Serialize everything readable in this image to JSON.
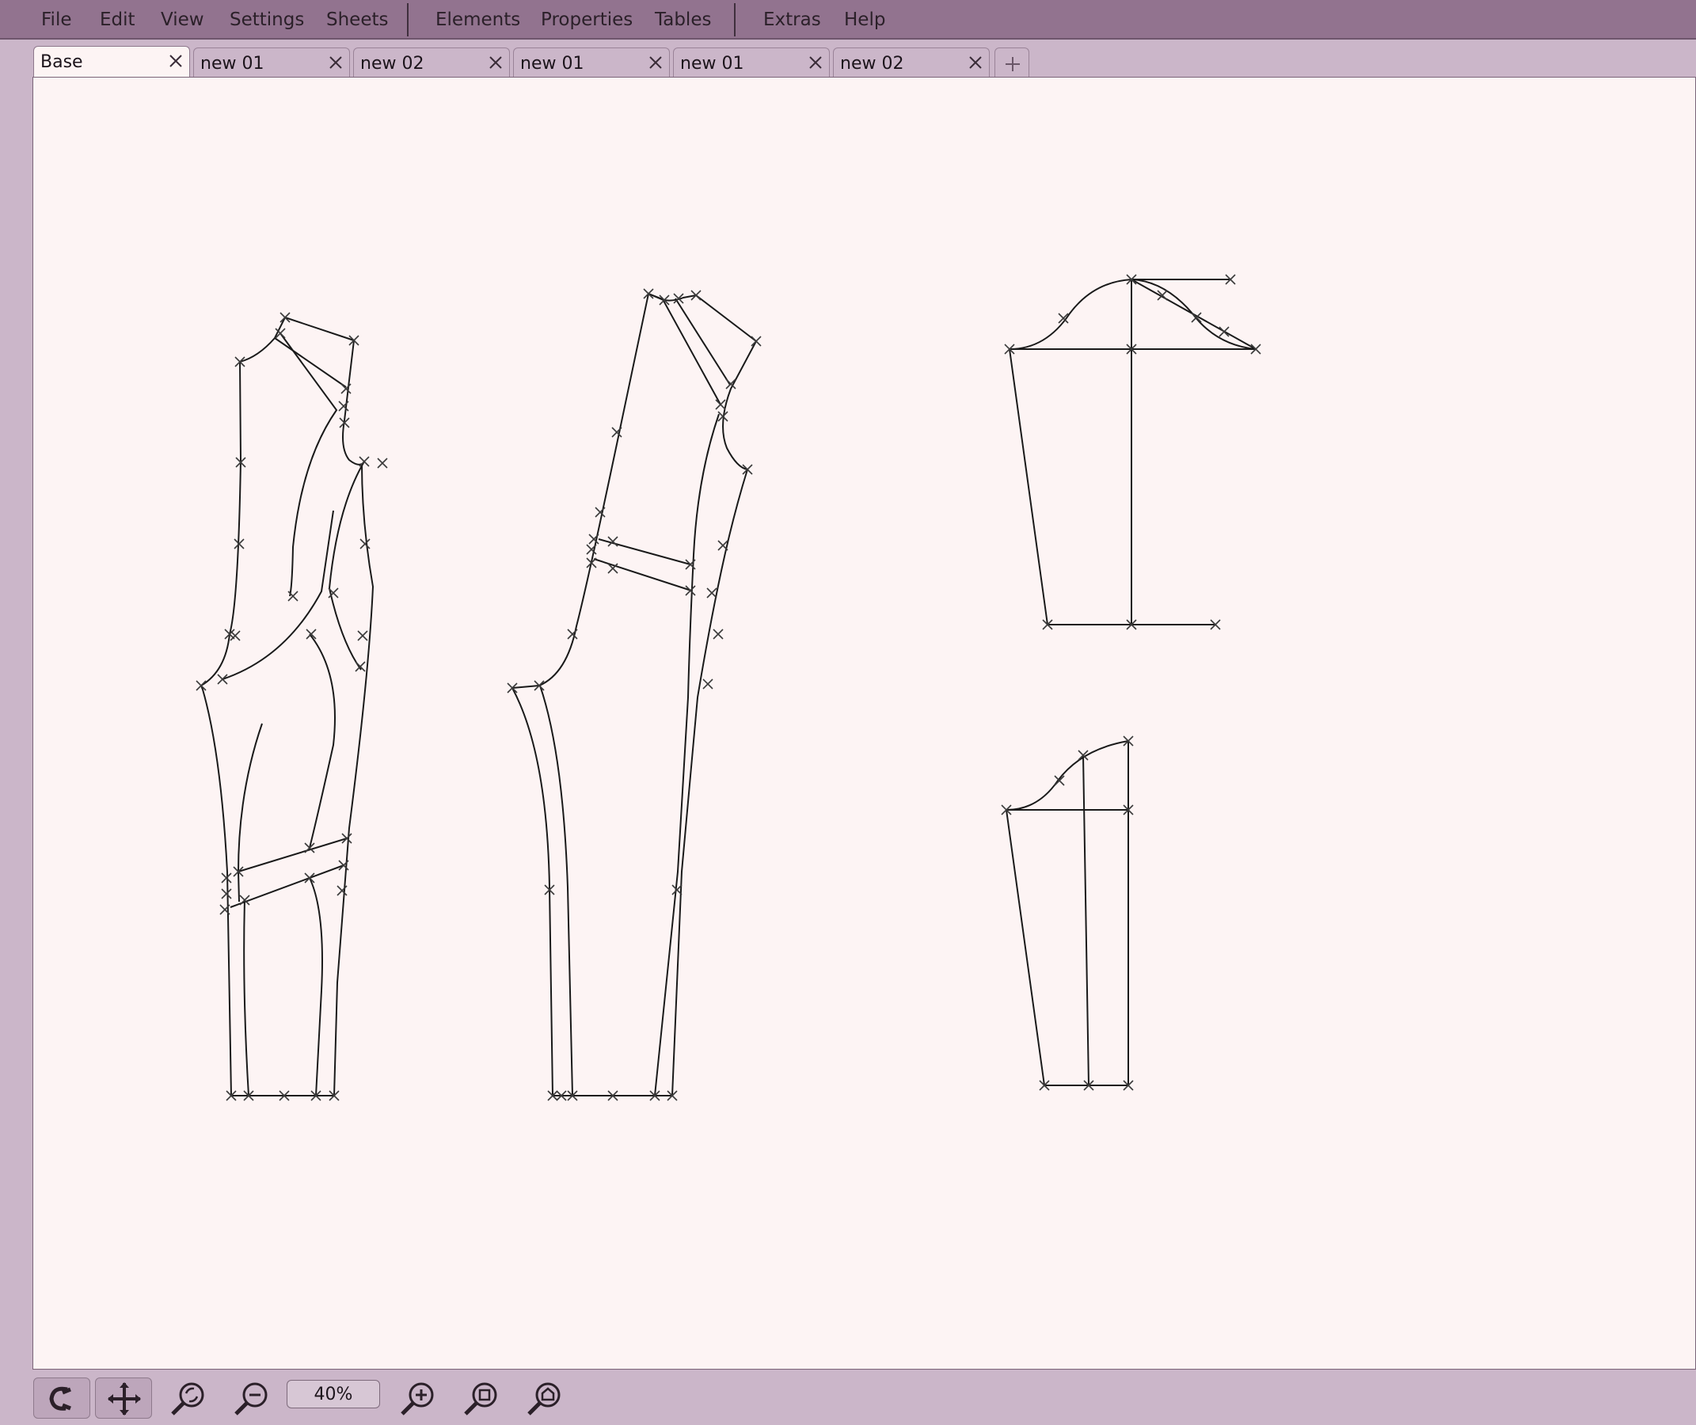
{
  "menu": {
    "file": "File",
    "edit": "Edit",
    "view": "View",
    "settings": "Settings",
    "sheets": "Sheets",
    "elements": "Elements",
    "properties": "Properties",
    "tables": "Tables",
    "extras": "Extras",
    "help": "Help"
  },
  "tabs": [
    {
      "label": "Base",
      "active": true
    },
    {
      "label": "new 01",
      "active": false
    },
    {
      "label": "new 02",
      "active": false
    },
    {
      "label": "new 01",
      "active": false
    },
    {
      "label": "new 01",
      "active": false
    },
    {
      "label": "new 02",
      "active": false
    }
  ],
  "tab_add_icon": "plus-icon",
  "toolbar": {
    "zoom_value": "40%",
    "icons": [
      "magnet-icon",
      "move-icon",
      "zoom-refresh-icon",
      "zoom-out-icon",
      "zoom-in-icon",
      "zoom-fit-icon",
      "zoom-home-icon"
    ]
  },
  "colors": {
    "menubar": "#92738f",
    "window_bg": "#cbb6c9",
    "canvas_bg": "#fdf4f4",
    "stroke": "#1a1a1a"
  }
}
